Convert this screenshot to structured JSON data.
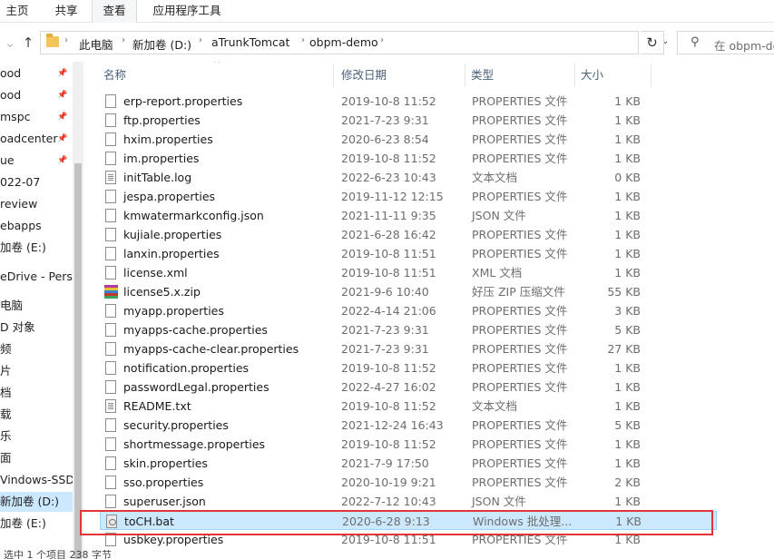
{
  "ribbon": {
    "tabs": [
      {
        "label": "主页"
      },
      {
        "label": "共享"
      },
      {
        "label": "查看"
      },
      {
        "label": "应用程序工具"
      }
    ]
  },
  "address": {
    "crumbs": [
      "此电脑",
      "新加卷 (D:)",
      "aTrunkTomcat",
      "obpm-demo"
    ],
    "search_placeholder": "在 obpm-de"
  },
  "nav": {
    "items": [
      {
        "label": "ood",
        "pinned": true
      },
      {
        "label": "ood",
        "pinned": true
      },
      {
        "label": "mspc",
        "pinned": true
      },
      {
        "label": "oadcenter",
        "pinned": true
      },
      {
        "label": "ue",
        "pinned": true
      },
      {
        "label": "022-07",
        "pinned": false
      },
      {
        "label": "review",
        "pinned": false
      },
      {
        "label": "ebapps",
        "pinned": false
      },
      {
        "label": "加卷 (E:)",
        "pinned": false
      },
      {
        "label": "eDrive - Perso",
        "pinned": false
      },
      {
        "label": "电脑",
        "pinned": false
      },
      {
        "label": "D 对象",
        "pinned": false
      },
      {
        "label": "频",
        "pinned": false
      },
      {
        "label": "片",
        "pinned": false
      },
      {
        "label": "档",
        "pinned": false
      },
      {
        "label": "载",
        "pinned": false
      },
      {
        "label": "乐",
        "pinned": false
      },
      {
        "label": "面",
        "pinned": false
      },
      {
        "label": "Vindows-SSD",
        "pinned": false
      },
      {
        "label": "新加卷 (D:)",
        "pinned": false,
        "selected": true
      },
      {
        "label": "加卷 (E:)",
        "pinned": false
      }
    ]
  },
  "columns": {
    "name": "名称",
    "date": "修改日期",
    "type": "类型",
    "size": "大小"
  },
  "files": [
    {
      "name": "erp-report.properties",
      "date": "2019-10-8 11:52",
      "type": "PROPERTIES 文件",
      "size": "1 KB",
      "icon": "file"
    },
    {
      "name": "ftp.properties",
      "date": "2021-7-23 9:31",
      "type": "PROPERTIES 文件",
      "size": "1 KB",
      "icon": "file"
    },
    {
      "name": "hxim.properties",
      "date": "2020-6-23 8:54",
      "type": "PROPERTIES 文件",
      "size": "1 KB",
      "icon": "file"
    },
    {
      "name": "im.properties",
      "date": "2019-10-8 11:52",
      "type": "PROPERTIES 文件",
      "size": "1 KB",
      "icon": "file"
    },
    {
      "name": "initTable.log",
      "date": "2022-6-23 10:43",
      "type": "文本文档",
      "size": "0 KB",
      "icon": "txt"
    },
    {
      "name": "jespa.properties",
      "date": "2019-11-12 12:15",
      "type": "PROPERTIES 文件",
      "size": "1 KB",
      "icon": "file"
    },
    {
      "name": "kmwatermarkconfig.json",
      "date": "2021-11-11 9:35",
      "type": "JSON 文件",
      "size": "1 KB",
      "icon": "file"
    },
    {
      "name": "kujiale.properties",
      "date": "2021-6-28 16:42",
      "type": "PROPERTIES 文件",
      "size": "1 KB",
      "icon": "file"
    },
    {
      "name": "lanxin.properties",
      "date": "2019-10-8 11:51",
      "type": "PROPERTIES 文件",
      "size": "1 KB",
      "icon": "file"
    },
    {
      "name": "license.xml",
      "date": "2019-10-8 11:51",
      "type": "XML 文档",
      "size": "1 KB",
      "icon": "file"
    },
    {
      "name": "license5.x.zip",
      "date": "2021-9-6 10:40",
      "type": "好压 ZIP 压缩文件",
      "size": "55 KB",
      "icon": "zip"
    },
    {
      "name": "myapp.properties",
      "date": "2022-4-14 21:06",
      "type": "PROPERTIES 文件",
      "size": "3 KB",
      "icon": "file"
    },
    {
      "name": "myapps-cache.properties",
      "date": "2021-7-23 9:31",
      "type": "PROPERTIES 文件",
      "size": "5 KB",
      "icon": "file"
    },
    {
      "name": "myapps-cache-clear.properties",
      "date": "2021-7-23 9:31",
      "type": "PROPERTIES 文件",
      "size": "27 KB",
      "icon": "file"
    },
    {
      "name": "notification.properties",
      "date": "2019-10-8 11:52",
      "type": "PROPERTIES 文件",
      "size": "1 KB",
      "icon": "file"
    },
    {
      "name": "passwordLegal.properties",
      "date": "2022-4-27 16:02",
      "type": "PROPERTIES 文件",
      "size": "1 KB",
      "icon": "file"
    },
    {
      "name": "README.txt",
      "date": "2019-10-8 11:52",
      "type": "文本文档",
      "size": "1 KB",
      "icon": "txt"
    },
    {
      "name": "security.properties",
      "date": "2021-12-24 16:43",
      "type": "PROPERTIES 文件",
      "size": "5 KB",
      "icon": "file"
    },
    {
      "name": "shortmessage.properties",
      "date": "2019-10-8 11:52",
      "type": "PROPERTIES 文件",
      "size": "1 KB",
      "icon": "file"
    },
    {
      "name": "skin.properties",
      "date": "2021-7-9 17:50",
      "type": "PROPERTIES 文件",
      "size": "1 KB",
      "icon": "file"
    },
    {
      "name": "sso.properties",
      "date": "2020-10-19 9:21",
      "type": "PROPERTIES 文件",
      "size": "2 KB",
      "icon": "file"
    },
    {
      "name": "superuser.json",
      "date": "2022-7-12 10:43",
      "type": "JSON 文件",
      "size": "1 KB",
      "icon": "file"
    },
    {
      "name": "toCH.bat",
      "date": "2020-6-28 9:13",
      "type": "Windows 批处理...",
      "size": "1 KB",
      "icon": "bat",
      "selected": true
    },
    {
      "name": "usbkey.properties",
      "date": "2019-10-8 11:51",
      "type": "PROPERTIES 文件",
      "size": "1 KB",
      "icon": "file"
    }
  ],
  "status": {
    "text": "选中 1 个项目  238 字节"
  }
}
